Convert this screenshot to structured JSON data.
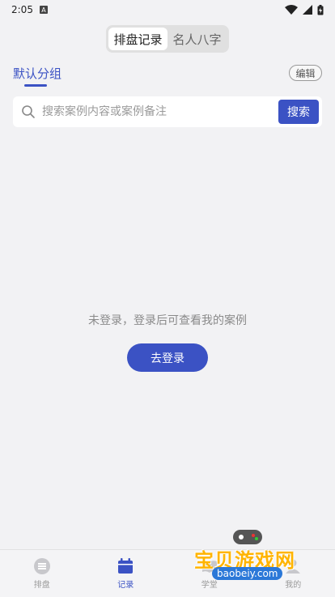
{
  "status": {
    "time": "2:05",
    "app_badge": "A"
  },
  "segmented": {
    "tabs": [
      "排盘记录",
      "名人八字"
    ],
    "active_index": 0
  },
  "group": {
    "label": "默认分组",
    "edit_label": "编辑"
  },
  "search": {
    "placeholder": "搜索案例内容或案例备注",
    "value": "",
    "button_label": "搜索"
  },
  "empty": {
    "message": "未登录，登录后可查看我的案例",
    "login_label": "去登录"
  },
  "nav": {
    "items": [
      {
        "label": "排盘",
        "icon": "layout-icon"
      },
      {
        "label": "记录",
        "icon": "calendar-icon"
      },
      {
        "label": "学堂",
        "icon": "book-icon"
      },
      {
        "label": "我的",
        "icon": "user-icon"
      }
    ],
    "active_index": 1
  },
  "watermark": {
    "title": "宝贝游戏网",
    "url": "baobeiy.com"
  },
  "colors": {
    "accent": "#3b52c4",
    "background": "#f2f2f4",
    "watermark": "#ffb400"
  }
}
